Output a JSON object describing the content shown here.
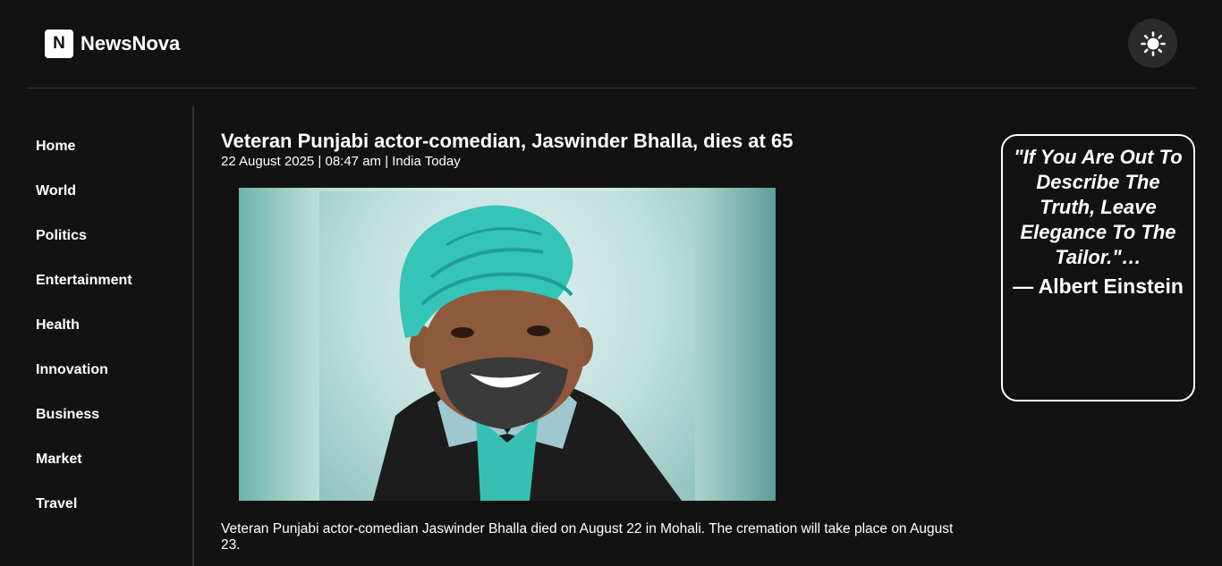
{
  "brand": {
    "logo_letter": "N",
    "name": "NewsNova"
  },
  "header": {
    "theme_toggle_icon": "sun-icon"
  },
  "nav": {
    "items": [
      {
        "label": "Home"
      },
      {
        "label": "World"
      },
      {
        "label": "Politics"
      },
      {
        "label": "Entertainment"
      },
      {
        "label": "Health"
      },
      {
        "label": "Innovation"
      },
      {
        "label": "Business"
      },
      {
        "label": "Market"
      },
      {
        "label": "Travel"
      }
    ]
  },
  "article": {
    "title": "Veteran Punjabi actor-comedian, Jaswinder Bhalla, dies at 65",
    "meta": "22 August 2025 | 08:47 am | India Today",
    "image": "portrait photo",
    "body": "Veteran Punjabi actor-comedian Jaswinder Bhalla died on August 22 in Mohali. The cremation will take place on August 23."
  },
  "quote": {
    "text": "\"If You Are Out To Describe The Truth, Leave Elegance To The Tailor.\"…",
    "author": "— Albert Einstein"
  },
  "colors": {
    "background": "#121212",
    "text": "#ffffff",
    "divider": "#333333",
    "turban": "#3cc9bf"
  }
}
